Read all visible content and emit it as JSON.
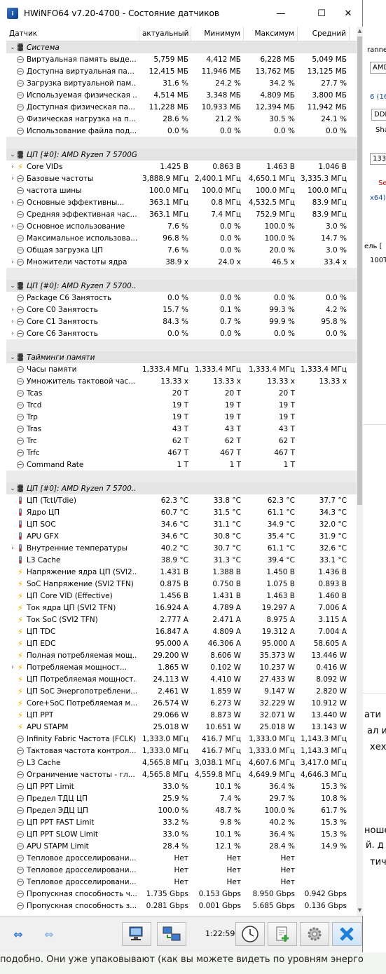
{
  "window": {
    "title": "HWiNFO64 v7.20-4700 - Состояние датчиков",
    "controls": {
      "minimize": "—",
      "maximize": "☐",
      "close": "✕"
    }
  },
  "columns": [
    "Датчик",
    "актуальный",
    "Минимум",
    "Максимум",
    "Средний"
  ],
  "rows": [
    {
      "type": "group",
      "expand": "v",
      "icon": "chip-icon",
      "label": "Система"
    },
    {
      "type": "item",
      "expand": "",
      "icon": "minus-circle-icon",
      "label": "Виртуальная память выде...",
      "cur": "5,759 МБ",
      "min": "4,412 МБ",
      "max": "6,228 МБ",
      "avg": "5,049 МБ"
    },
    {
      "type": "item",
      "expand": "",
      "icon": "minus-circle-icon",
      "label": "Доступна виртуальная па...",
      "cur": "12,415 МБ",
      "min": "11,946 МБ",
      "max": "13,762 МБ",
      "avg": "13,125 МБ"
    },
    {
      "type": "item",
      "expand": "",
      "icon": "minus-circle-icon",
      "label": "Загрузка виртуальной пам...",
      "cur": "31.6 %",
      "min": "24.2 %",
      "max": "34.2 %",
      "avg": "27.7 %"
    },
    {
      "type": "item",
      "expand": "",
      "icon": "minus-circle-icon",
      "label": "Используемая физическая ...",
      "cur": "4,514 МБ",
      "min": "3,348 МБ",
      "max": "4,809 МБ",
      "avg": "3,800 МБ"
    },
    {
      "type": "item",
      "expand": "",
      "icon": "minus-circle-icon",
      "label": "Доступная физическая па...",
      "cur": "11,228 МБ",
      "min": "10,933 МБ",
      "max": "12,394 МБ",
      "avg": "11,942 МБ"
    },
    {
      "type": "item",
      "expand": "",
      "icon": "minus-circle-icon",
      "label": "Физическая нагрузка на п...",
      "cur": "28.6 %",
      "min": "21.2 %",
      "max": "30.5 %",
      "avg": "24.1 %"
    },
    {
      "type": "item",
      "expand": "",
      "icon": "minus-circle-icon",
      "label": "Использование файла под...",
      "cur": "0.0 %",
      "min": "0.0 %",
      "max": "0.0 %",
      "avg": "0.0 %"
    },
    {
      "type": "blank"
    },
    {
      "type": "group",
      "expand": "v",
      "icon": "chip-icon",
      "label": "ЦП [#0]: AMD Ryzen 7 5700G"
    },
    {
      "type": "item",
      "expand": ">",
      "icon": "bolt-icon",
      "label": "Core VIDs",
      "cur": "1.425 В",
      "min": "0.863 В",
      "max": "1.463 В",
      "avg": "1.046 В"
    },
    {
      "type": "item",
      "expand": ">",
      "icon": "minus-circle-icon",
      "label": "Базовые частоты",
      "cur": "3,888.9 МГц",
      "min": "2,400.1 МГц",
      "max": "4,650.1 МГц",
      "avg": "3,335.3 МГц"
    },
    {
      "type": "item",
      "expand": "",
      "icon": "minus-circle-icon",
      "label": "частота шины",
      "cur": "100.0 МГц",
      "min": "100.0 МГц",
      "max": "100.0 МГц",
      "avg": "100.0 МГц"
    },
    {
      "type": "item",
      "expand": ">",
      "icon": "minus-circle-icon",
      "label": "Основные эффективны...",
      "cur": "363.1 МГц",
      "min": "0.8 МГц",
      "max": "4,532.5 МГц",
      "avg": "83.9 МГц"
    },
    {
      "type": "item",
      "expand": "",
      "icon": "minus-circle-icon",
      "label": "Средняя эффективная час...",
      "cur": "363.1 МГц",
      "min": "7.4 МГц",
      "max": "752.9 МГц",
      "avg": "83.9 МГц"
    },
    {
      "type": "item",
      "expand": ">",
      "icon": "minus-circle-icon",
      "label": "Основное использование",
      "cur": "7.6 %",
      "min": "0.0 %",
      "max": "100.0 %",
      "avg": "3.0 %"
    },
    {
      "type": "item",
      "expand": "",
      "icon": "minus-circle-icon",
      "label": "Максимальное использова...",
      "cur": "96.8 %",
      "min": "0.0 %",
      "max": "100.0 %",
      "avg": "14.7 %"
    },
    {
      "type": "item",
      "expand": "",
      "icon": "minus-circle-icon",
      "label": "Общая загрузка ЦП",
      "cur": "7.6 %",
      "min": "0.0 %",
      "max": "20.0 %",
      "avg": "3.0 %"
    },
    {
      "type": "item",
      "expand": ">",
      "icon": "minus-circle-icon",
      "label": "Множители частоты ядра",
      "cur": "38.9 x",
      "min": "24.0 x",
      "max": "46.5 x",
      "avg": "33.4 x"
    },
    {
      "type": "blank"
    },
    {
      "type": "group",
      "expand": "v",
      "icon": "chip-icon",
      "label": "ЦП [#0]: AMD Ryzen 7 5700..."
    },
    {
      "type": "item",
      "expand": "",
      "icon": "minus-circle-icon",
      "label": "Package C6 Занятость",
      "cur": "0.0 %",
      "min": "0.0 %",
      "max": "0.0 %",
      "avg": "0.0 %"
    },
    {
      "type": "item",
      "expand": ">",
      "icon": "minus-circle-icon",
      "label": "Core C0 Занятость",
      "cur": "15.7 %",
      "min": "0.1 %",
      "max": "99.3 %",
      "avg": "4.2 %"
    },
    {
      "type": "item",
      "expand": ">",
      "icon": "minus-circle-icon",
      "label": "Core C1 Занятость",
      "cur": "84.3 %",
      "min": "0.7 %",
      "max": "99.9 %",
      "avg": "95.8 %"
    },
    {
      "type": "item",
      "expand": ">",
      "icon": "minus-circle-icon",
      "label": "Core C6 Занятость",
      "cur": "0.0 %",
      "min": "0.0 %",
      "max": "0.0 %",
      "avg": "0.0 %"
    },
    {
      "type": "blank"
    },
    {
      "type": "group",
      "expand": "v",
      "icon": "chip-icon",
      "label": "Тайминги памяти"
    },
    {
      "type": "item",
      "expand": "",
      "icon": "minus-circle-icon",
      "label": "Часы памяти",
      "cur": "1,333.4 МГц",
      "min": "1,333.4 МГц",
      "max": "1,333.4 МГц",
      "avg": "1,333.4 МГц"
    },
    {
      "type": "item",
      "expand": "",
      "icon": "minus-circle-icon",
      "label": "Умножитель тактовой час...",
      "cur": "13.33 x",
      "min": "13.33 x",
      "max": "13.33 x",
      "avg": "13.33 x"
    },
    {
      "type": "item",
      "expand": "",
      "icon": "minus-circle-icon",
      "label": "Tcas",
      "cur": "20 T",
      "min": "20 T",
      "max": "20 T",
      "avg": ""
    },
    {
      "type": "item",
      "expand": "",
      "icon": "minus-circle-icon",
      "label": "Trcd",
      "cur": "19 T",
      "min": "19 T",
      "max": "19 T",
      "avg": ""
    },
    {
      "type": "item",
      "expand": "",
      "icon": "minus-circle-icon",
      "label": "Trp",
      "cur": "19 T",
      "min": "19 T",
      "max": "19 T",
      "avg": ""
    },
    {
      "type": "item",
      "expand": "",
      "icon": "minus-circle-icon",
      "label": "Tras",
      "cur": "43 T",
      "min": "43 T",
      "max": "43 T",
      "avg": ""
    },
    {
      "type": "item",
      "expand": "",
      "icon": "minus-circle-icon",
      "label": "Trc",
      "cur": "62 T",
      "min": "62 T",
      "max": "62 T",
      "avg": ""
    },
    {
      "type": "item",
      "expand": "",
      "icon": "minus-circle-icon",
      "label": "Trfc",
      "cur": "467 T",
      "min": "467 T",
      "max": "467 T",
      "avg": ""
    },
    {
      "type": "item",
      "expand": "",
      "icon": "minus-circle-icon",
      "label": "Command Rate",
      "cur": "1 T",
      "min": "1 T",
      "max": "1 T",
      "avg": ""
    },
    {
      "type": "blank"
    },
    {
      "type": "group",
      "expand": "v",
      "icon": "chip-icon",
      "label": "ЦП [#0]: AMD Ryzen 7 5700..."
    },
    {
      "type": "item",
      "expand": "",
      "icon": "thermometer-icon",
      "label": "ЦП (Tctl/Tdie)",
      "cur": "62.3 °C",
      "min": "33.8 °C",
      "max": "62.3 °C",
      "avg": "37.7 °C"
    },
    {
      "type": "item",
      "expand": "",
      "icon": "thermometer-icon",
      "label": "Ядро ЦП",
      "cur": "60.7 °C",
      "min": "31.5 °C",
      "max": "61.1 °C",
      "avg": "34.3 °C"
    },
    {
      "type": "item",
      "expand": "",
      "icon": "thermometer-icon",
      "label": "ЦП SOC",
      "cur": "34.6 °C",
      "min": "31.1 °C",
      "max": "34.9 °C",
      "avg": "32.0 °C"
    },
    {
      "type": "item",
      "expand": "",
      "icon": "thermometer-icon",
      "label": "APU GFX",
      "cur": "34.6 °C",
      "min": "30.8 °C",
      "max": "35.4 °C",
      "avg": "31.9 °C"
    },
    {
      "type": "item",
      "expand": ">",
      "icon": "thermometer-icon",
      "label": "Внутренние температуры",
      "cur": "40.2 °C",
      "min": "30.7 °C",
      "max": "61.1 °C",
      "avg": "32.6 °C"
    },
    {
      "type": "item",
      "expand": "",
      "icon": "thermometer-icon",
      "label": "L3 Cache",
      "cur": "38.9 °C",
      "min": "31.3 °C",
      "max": "39.4 °C",
      "avg": "33.1 °C"
    },
    {
      "type": "item",
      "expand": "",
      "icon": "bolt-icon",
      "label": "Напряжение ядра ЦП (SVI2...",
      "cur": "1.431 В",
      "min": "1.388 В",
      "max": "1.450 В",
      "avg": "1.436 В"
    },
    {
      "type": "item",
      "expand": "",
      "icon": "bolt-icon",
      "label": "SoC Напряжение (SVI2 TFN)",
      "cur": "0.875 В",
      "min": "0.750 В",
      "max": "1.075 В",
      "avg": "0.893 В"
    },
    {
      "type": "item",
      "expand": "",
      "icon": "bolt-icon",
      "label": "ЦП Core VID (Effective)",
      "cur": "1.456 В",
      "min": "1.431 В",
      "max": "1.463 В",
      "avg": "1.460 В"
    },
    {
      "type": "item",
      "expand": "",
      "icon": "bolt-icon",
      "label": "Ток ядра ЦП (SVI2 TFN)",
      "cur": "16.924 A",
      "min": "4.789 A",
      "max": "19.297 A",
      "avg": "7.006 A"
    },
    {
      "type": "item",
      "expand": "",
      "icon": "bolt-icon",
      "label": "Ток SoC (SVI2 TFN)",
      "cur": "2.777 A",
      "min": "2.471 A",
      "max": "8.975 A",
      "avg": "3.115 A"
    },
    {
      "type": "item",
      "expand": "",
      "icon": "bolt-icon",
      "label": "ЦП TDC",
      "cur": "16.847 A",
      "min": "4.809 A",
      "max": "19.312 A",
      "avg": "7.004 A"
    },
    {
      "type": "item",
      "expand": "",
      "icon": "bolt-icon",
      "label": "ЦП EDC",
      "cur": "95.000 A",
      "min": "46.306 A",
      "max": "95.000 A",
      "avg": "58.605 A"
    },
    {
      "type": "item",
      "expand": "",
      "icon": "bolt-icon",
      "label": "Полная потребляемая мощ...",
      "cur": "29.200 W",
      "min": "8.606 W",
      "max": "35.373 W",
      "avg": "13.446 W"
    },
    {
      "type": "item",
      "expand": ">",
      "icon": "bolt-icon",
      "label": "Потребляемая мощност...",
      "cur": "1.865 W",
      "min": "0.102 W",
      "max": "10.237 W",
      "avg": "0.416 W"
    },
    {
      "type": "item",
      "expand": "",
      "icon": "bolt-icon",
      "label": "ЦП Потребляемая мощност...",
      "cur": "24.113 W",
      "min": "4.410 W",
      "max": "27.433 W",
      "avg": "8.092 W"
    },
    {
      "type": "item",
      "expand": "",
      "icon": "bolt-icon",
      "label": "ЦП SoC Энергопотреблени...",
      "cur": "2.461 W",
      "min": "1.859 W",
      "max": "9.147 W",
      "avg": "2.820 W"
    },
    {
      "type": "item",
      "expand": "",
      "icon": "bolt-icon",
      "label": "Core+SoC Потребляемая м...",
      "cur": "26.574 W",
      "min": "6.273 W",
      "max": "32.229 W",
      "avg": "10.912 W"
    },
    {
      "type": "item",
      "expand": "",
      "icon": "bolt-icon",
      "label": "ЦП PPT",
      "cur": "29.066 W",
      "min": "8.873 W",
      "max": "32.071 W",
      "avg": "13.440 W"
    },
    {
      "type": "item",
      "expand": "",
      "icon": "bolt-icon",
      "label": "APU STAPM",
      "cur": "25.018 W",
      "min": "10.651 W",
      "max": "25.018 W",
      "avg": "13.143 W"
    },
    {
      "type": "item",
      "expand": "",
      "icon": "minus-circle-icon",
      "label": "Infinity Fabric Частота (FCLK)",
      "cur": "1,333.0 МГц",
      "min": "416.7 МГц",
      "max": "1,333.0 МГц",
      "avg": "1,143.3 МГц"
    },
    {
      "type": "item",
      "expand": "",
      "icon": "minus-circle-icon",
      "label": "Тактовая частота контрол...",
      "cur": "1,333.0 МГц",
      "min": "416.7 МГц",
      "max": "1,333.0 МГц",
      "avg": "1,143.3 МГц"
    },
    {
      "type": "item",
      "expand": "",
      "icon": "minus-circle-icon",
      "label": "L3 Cache",
      "cur": "4,565.8 МГц",
      "min": "3,038.1 МГц",
      "max": "4,607.6 МГц",
      "avg": "3,417.0 МГц"
    },
    {
      "type": "item",
      "expand": "",
      "icon": "minus-circle-icon",
      "label": "Ограничение частоты - гл...",
      "cur": "4,565.8 МГц",
      "min": "4,559.8 МГц",
      "max": "4,649.9 МГц",
      "avg": "4,646.3 МГц"
    },
    {
      "type": "item",
      "expand": "",
      "icon": "minus-circle-icon",
      "label": "ЦП PPT Limit",
      "cur": "33.0 %",
      "min": "10.1 %",
      "max": "36.4 %",
      "avg": "15.3 %"
    },
    {
      "type": "item",
      "expand": "",
      "icon": "minus-circle-icon",
      "label": "Предел ТДЦ ЦП",
      "cur": "25.9 %",
      "min": "7.4 %",
      "max": "29.7 %",
      "avg": "10.8 %"
    },
    {
      "type": "item",
      "expand": "",
      "icon": "minus-circle-icon",
      "label": "Предел ЭДЦ ЦП",
      "cur": "100.0 %",
      "min": "48.7 %",
      "max": "100.0 %",
      "avg": "61.7 %"
    },
    {
      "type": "item",
      "expand": "",
      "icon": "minus-circle-icon",
      "label": "ЦП PPT FAST Limit",
      "cur": "33.2 %",
      "min": "9.8 %",
      "max": "40.2 %",
      "avg": "15.3 %"
    },
    {
      "type": "item",
      "expand": "",
      "icon": "minus-circle-icon",
      "label": "ЦП PPT SLOW Limit",
      "cur": "33.0 %",
      "min": "10.1 %",
      "max": "36.4 %",
      "avg": "15.3 %"
    },
    {
      "type": "item",
      "expand": "",
      "icon": "minus-circle-icon",
      "label": "APU STAPM Limit",
      "cur": "28.4 %",
      "min": "12.1 %",
      "max": "28.4 %",
      "avg": "14.9 %"
    },
    {
      "type": "item",
      "expand": "",
      "icon": "minus-circle-icon",
      "label": "Тепловое дросселировани...",
      "cur": "Нет",
      "min": "Нет",
      "max": "Нет",
      "avg": ""
    },
    {
      "type": "item",
      "expand": "",
      "icon": "minus-circle-icon",
      "label": "Тепловое дросселировани...",
      "cur": "Нет",
      "min": "Нет",
      "max": "Нет",
      "avg": ""
    },
    {
      "type": "item",
      "expand": "",
      "icon": "minus-circle-icon",
      "label": "Тепловое дросселировани...",
      "cur": "Нет",
      "min": "Нет",
      "max": "Нет",
      "avg": ""
    },
    {
      "type": "item",
      "expand": "",
      "icon": "minus-circle-icon",
      "label": "Пропускная способность ч...",
      "cur": "1.735 Gbps",
      "min": "0.153 Gbps",
      "max": "8.950 Gbps",
      "avg": "0.942 Gbps"
    },
    {
      "type": "item",
      "expand": "",
      "icon": "minus-circle-icon",
      "label": "Пропускная способность з...",
      "cur": "0.281 Gbps",
      "min": "0.001 Gbps",
      "max": "5.685 Gbps",
      "avg": "0.136 Gbps"
    }
  ],
  "toolbar": {
    "nav_left": "⇔",
    "nav_right": "⇔",
    "clock": "1:22:59"
  },
  "background": {
    "right_fragments": [
      "ranne",
      "AMD",
      "6 (16",
      "DDI",
      "Sha",
      "1333",
      "Se",
      "x64)",
      "ель [",
      "100T",
      "ати",
      "ал и",
      "хех",
      "ноше",
      "й. д",
      "тич"
    ],
    "bottom_text": "подобно. Они уже упаковывают (как вы можете видеть по уровням энерго"
  },
  "colors": {
    "group_bg": "#e4e4e4",
    "bolt": "#f1b400",
    "close_button": "#1e7fd6"
  }
}
